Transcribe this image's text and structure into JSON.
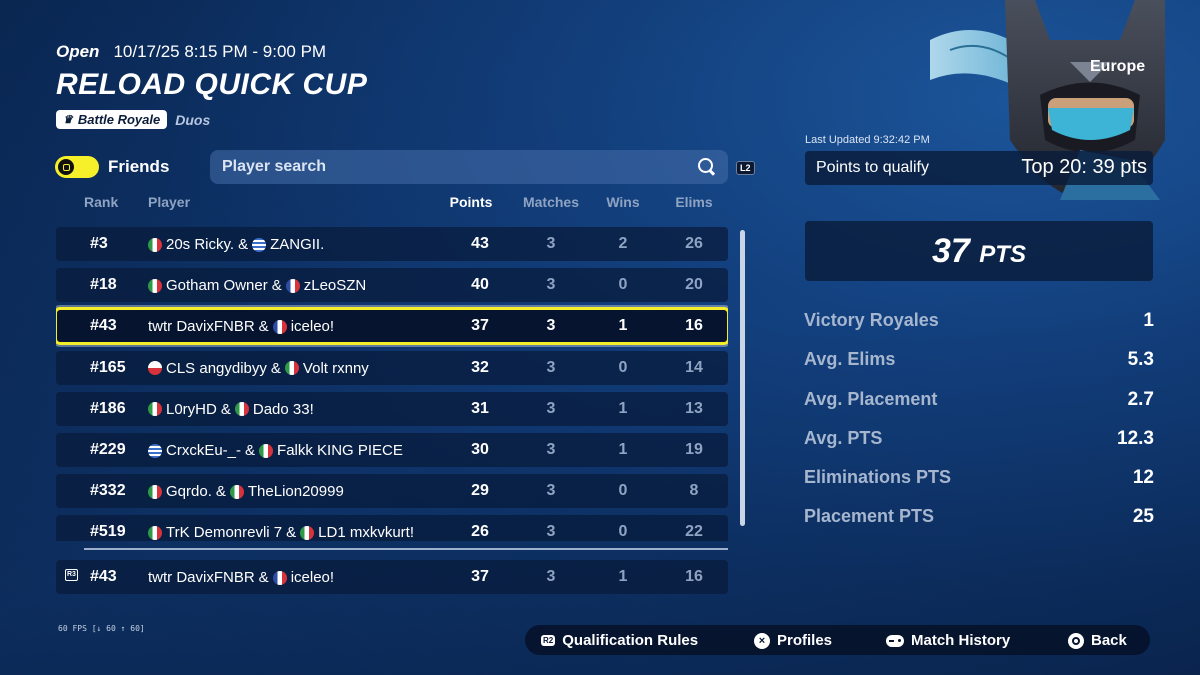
{
  "header": {
    "status": "Open",
    "time": "10/17/25 8:15 PM - 9:00 PM",
    "title": "RELOAD QUICK CUP",
    "mode": "Battle Royale",
    "team_type": "Duos"
  },
  "filters": {
    "friends_label": "Friends",
    "search_placeholder": "Player search",
    "search_hint": "L2"
  },
  "table": {
    "headers": {
      "rank": "Rank",
      "player": "Player",
      "points": "Points",
      "matches": "Matches",
      "wins": "Wins",
      "elims": "Elims"
    },
    "rows": [
      {
        "rank": "#3",
        "p1_flag": "it",
        "p1": "20s Ricky.",
        "p2_flag": "gr",
        "p2": "ZANGII.",
        "points": "43",
        "matches": "3",
        "wins": "2",
        "elims": "26"
      },
      {
        "rank": "#18",
        "p1_flag": "it",
        "p1": "Gotham Owner",
        "p2_flag": "fr",
        "p2": "zLeoSZN",
        "points": "40",
        "matches": "3",
        "wins": "0",
        "elims": "20"
      },
      {
        "rank": "#43",
        "p1_flag": "",
        "p1": "twtr DavixFNBR",
        "p2_flag": "fr",
        "p2": "iceleo!",
        "points": "37",
        "matches": "3",
        "wins": "1",
        "elims": "16"
      },
      {
        "rank": "#165",
        "p1_flag": "pl",
        "p1": "CLS angydibyy",
        "p2_flag": "it",
        "p2": "Volt rxnny",
        "points": "32",
        "matches": "3",
        "wins": "0",
        "elims": "14"
      },
      {
        "rank": "#186",
        "p1_flag": "it",
        "p1": "L0ryHD",
        "p2_flag": "it",
        "p2": "Dado 33!",
        "points": "31",
        "matches": "3",
        "wins": "1",
        "elims": "13"
      },
      {
        "rank": "#229",
        "p1_flag": "gr",
        "p1": "CrxckEu-_-",
        "p2_flag": "it",
        "p2": "Falkk KING PIECE",
        "points": "30",
        "matches": "3",
        "wins": "1",
        "elims": "19"
      },
      {
        "rank": "#332",
        "p1_flag": "it",
        "p1": "Gqrdo.",
        "p2_flag": "it",
        "p2": "TheLion20999",
        "points": "29",
        "matches": "3",
        "wins": "0",
        "elims": "8"
      },
      {
        "rank": "#519",
        "p1_flag": "it",
        "p1": "TrK Demonrevli 7",
        "p2_flag": "it",
        "p2": "LD1 mxkvkurt!",
        "points": "26",
        "matches": "3",
        "wins": "0",
        "elims": "22"
      }
    ],
    "selected_index": 2,
    "my_row": {
      "rank": "#43",
      "p1": "twtr DavixFNBR",
      "p2_flag": "fr",
      "p2": "iceleo!",
      "points": "37",
      "matches": "3",
      "wins": "1",
      "elims": "16",
      "button_hint": "R3"
    }
  },
  "fps": "60 FPS [↓ 60 ↑ 60]",
  "right_panel": {
    "region": "Europe",
    "last_updated": "Last Updated 9:32:42 PM",
    "qualify_label": "Points to qualify",
    "qualify_value": "Top 20: 39 pts",
    "total_points": "37",
    "total_points_unit": "PTS",
    "stats": [
      {
        "label": "Victory Royales",
        "value": "1"
      },
      {
        "label": "Avg. Elims",
        "value": "5.3"
      },
      {
        "label": "Avg. Placement",
        "value": "2.7"
      },
      {
        "label": "Avg. PTS",
        "value": "12.3"
      },
      {
        "label": "Eliminations PTS",
        "value": "12"
      },
      {
        "label": "Placement PTS",
        "value": "25"
      }
    ]
  },
  "bottom_bar": {
    "qualification": {
      "hint": "R2",
      "label": "Qualification Rules"
    },
    "profiles": {
      "hint": "×",
      "label": "Profiles"
    },
    "history": {
      "hint": "gamepad-icon",
      "label": "Match History"
    },
    "back": {
      "hint": "circle",
      "label": "Back"
    }
  },
  "colors": {
    "accent_yellow": "#f4ee2a",
    "row_bg": "#081a3a",
    "bg": "#0b2a58"
  }
}
